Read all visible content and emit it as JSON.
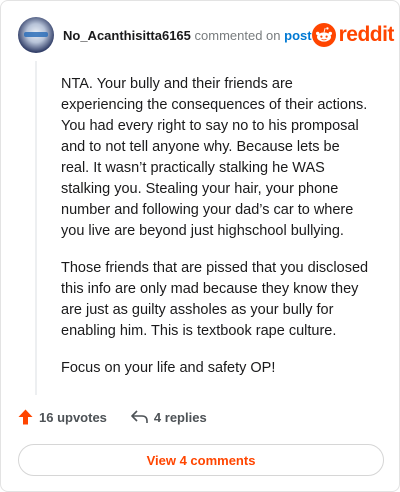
{
  "comment": {
    "username": "No_Acanthisitta6165",
    "action_text": "commented on",
    "post_link": "post",
    "paragraphs": [
      "NTA. Your bully and their friends are experiencing the consequences of their actions. You had every right to say no to his promposal and to not tell anyone why. Because lets be real. It wasn’t practically stalking he WAS stalking you. Stealing your hair, your phone number and following your dad’s car to where you live are beyond just highschool bullying.",
      "Those friends that are pissed that you disclosed this info are only mad because they know they are just as guilty assholes as your bully for enabling him. This is textbook rape culture.",
      "Focus on your life and safety OP!"
    ]
  },
  "brand": {
    "logo_text": "reddit",
    "icon": "reddit-snoo-icon",
    "color": "#ff4500"
  },
  "actions": {
    "upvotes": "16 upvotes",
    "replies": "4 replies",
    "upvote_icon": "upvote-arrow-icon",
    "reply_icon": "reply-arrow-icon",
    "upvote_color": "#ff4500"
  },
  "footer": {
    "view_comments": "View 4 comments"
  }
}
